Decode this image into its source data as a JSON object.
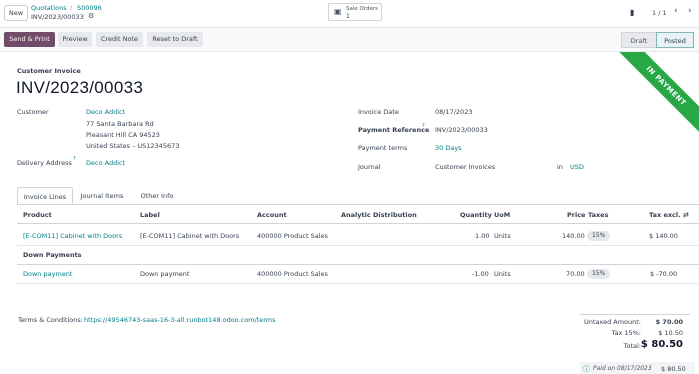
{
  "topbar": {
    "new_label": "New",
    "breadcrumb": {
      "parent1": "Quotations",
      "sep": "/",
      "parent2": "S00096",
      "current": "INV/2023/00033",
      "gear_icon": "gear-icon"
    },
    "smart_button": {
      "icon": "dollar-icon",
      "label": "Sale Orders",
      "count": "1"
    },
    "book_icon": "book-icon",
    "pager": {
      "value": "1 / 1",
      "prev": "‹",
      "next": "›"
    }
  },
  "actions": {
    "send_print": "Send & Print",
    "preview": "Preview",
    "credit_note": "Credit Note",
    "reset_draft": "Reset to Draft"
  },
  "status": {
    "draft": "Draft",
    "posted": "Posted"
  },
  "ribbon": {
    "text": "IN PAYMENT",
    "color": "#28a745"
  },
  "document": {
    "type": "Customer Invoice",
    "name": "INV/2023/00033"
  },
  "left_fields": {
    "customer_label": "Customer",
    "customer_name": "Deco Addict",
    "address_line1": "77 Santa Barbara Rd",
    "address_line2": "Pleasant Hill CA 94523",
    "address_line3": "United States – US12345673",
    "delivery_label": "Delivery Address",
    "delivery_help": "?",
    "delivery_value": "Deco Addict"
  },
  "right_fields": {
    "invoice_date_label": "Invoice Date",
    "invoice_date": "08/17/2023",
    "payment_ref_label": "Payment Reference",
    "payment_ref_help": "?",
    "payment_ref": "INV/2023/00033",
    "payment_terms_label": "Payment terms",
    "payment_terms": "30 Days",
    "journal_label": "Journal",
    "journal": "Customer Invoices",
    "in_label": "in",
    "currency": "USD"
  },
  "tabs": [
    "Invoice Lines",
    "Journal Items",
    "Other Info"
  ],
  "table": {
    "headers": {
      "product": "Product",
      "label": "Label",
      "account": "Account",
      "analytic": "Analytic Distribution",
      "quantity": "Quantity",
      "uom": "UoM",
      "price": "Price",
      "taxes": "Taxes",
      "tax_excl": "Tax excl.",
      "settings_icon": "column-settings-icon"
    },
    "rows": [
      {
        "product": "[E-COM11] Cabinet with Doors",
        "label": "[E-COM11] Cabinet with Doors",
        "account": "400000 Product Sales",
        "quantity": "1.00",
        "uom": "Units",
        "price": "140.00",
        "tax": "15%",
        "subtotal": "$ 140.00"
      },
      {
        "section": "Down Payments"
      },
      {
        "product": "Down payment",
        "label": "Down payment",
        "account": "400000 Product Sales",
        "quantity": "-1.00",
        "uom": "Units",
        "price": "70.00",
        "tax": "15%",
        "subtotal": "$ -70.00"
      }
    ]
  },
  "terms": {
    "label": "Terms & Conditions:",
    "link": "https://49546743-saas-16-3-all.runbot148.odoo.com/terms"
  },
  "totals": {
    "untaxed_label": "Untaxed Amount:",
    "untaxed": "$ 70.00",
    "tax_label": "Tax 15%:",
    "tax": "$ 10.50",
    "total_label": "Total:",
    "total": "$ 80.50",
    "paid_icon": "info-icon",
    "paid_label": "Paid on 08/17/2023",
    "paid_amount": "$ 80.50"
  },
  "colors": {
    "primary": "#714b67",
    "link": "#017e84",
    "ribbon": "#28a745"
  }
}
